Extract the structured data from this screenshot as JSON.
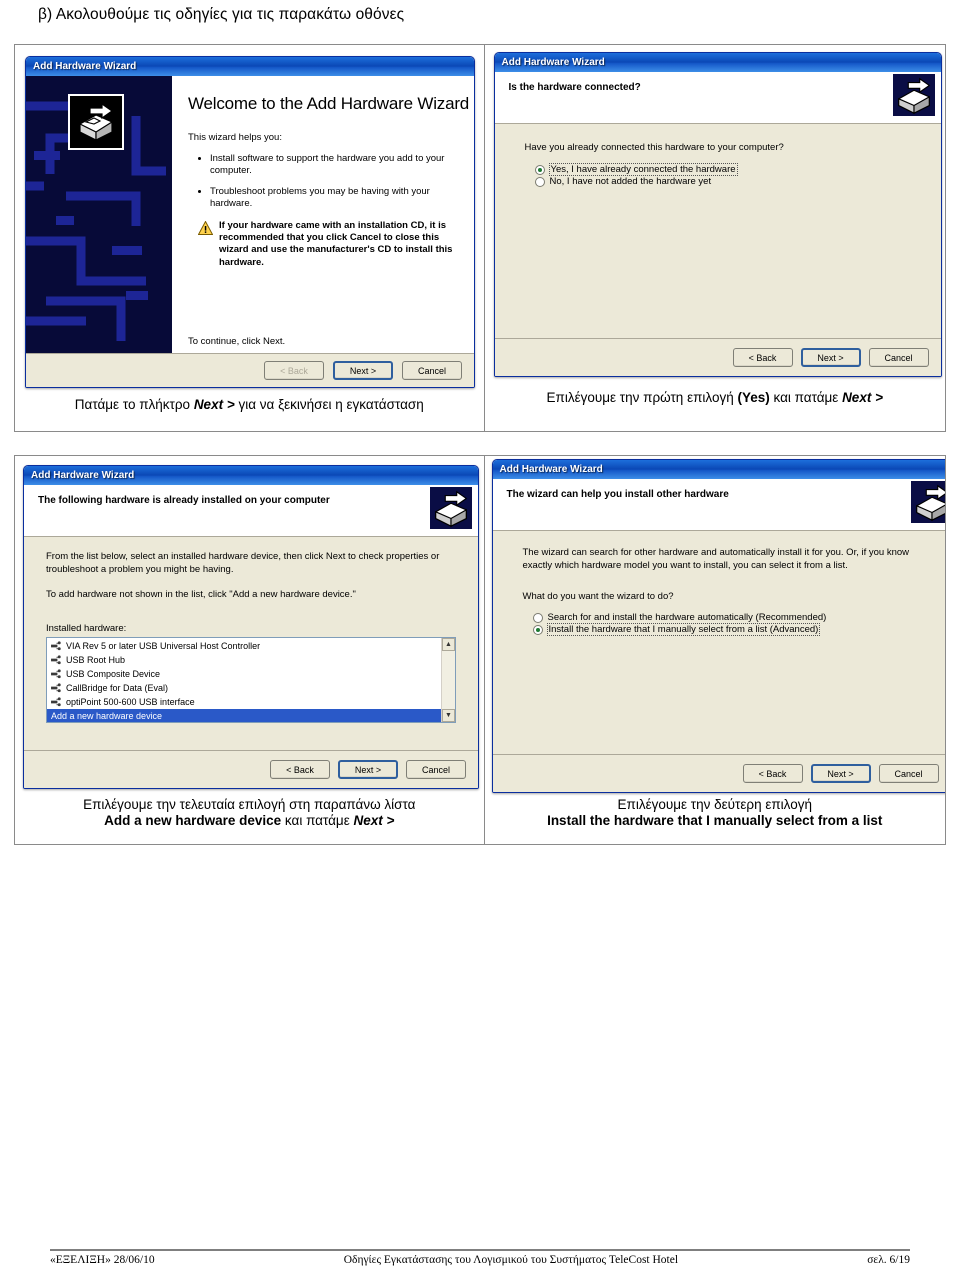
{
  "page": {
    "heading": "β) Ακολουθούμε τις οδηγίες για τις παρακάτω οθόνες"
  },
  "window_title": "Add Hardware Wizard",
  "wizard1": {
    "title": "Add Hardware Wizard",
    "heading": "Welcome to the Add Hardware Wizard",
    "intro": "This wizard helps you:",
    "bullets": [
      "Install software to support the hardware you add to your computer.",
      "Troubleshoot problems you may be having with your hardware."
    ],
    "warning": "If your hardware came with an installation CD, it is recommended that you click Cancel to close this wizard and use the manufacturer's CD to install this hardware.",
    "continue": "To continue, click Next.",
    "buttons": {
      "back": "< Back",
      "next": "Next >",
      "cancel": "Cancel"
    }
  },
  "wizard2": {
    "title": "Add Hardware Wizard",
    "heading": "Is the hardware connected?",
    "question": "Have you already connected this hardware to your computer?",
    "options": [
      {
        "label": "Yes, I have already connected the hardware",
        "selected": true
      },
      {
        "label": "No, I have not added the hardware yet",
        "selected": false
      }
    ],
    "buttons": {
      "back": "< Back",
      "next": "Next >",
      "cancel": "Cancel"
    }
  },
  "wizard3": {
    "title": "Add Hardware Wizard",
    "heading": "The following hardware is already installed on your computer",
    "para1": "From the list below, select an installed hardware device, then click Next to check properties or troubleshoot a problem you might be having.",
    "para2": "To add hardware not shown in the list, click \"Add a new hardware device.\"",
    "list_label": "Installed hardware:",
    "list_items": [
      {
        "label": "VIA Rev 5 or later USB Universal Host Controller",
        "selected": false
      },
      {
        "label": "USB Root Hub",
        "selected": false
      },
      {
        "label": "USB Composite Device",
        "selected": false
      },
      {
        "label": "CallBridge for Data (Eval)",
        "selected": false
      },
      {
        "label": "optiPoint 500-600 USB interface",
        "selected": false
      },
      {
        "label": "Add a new hardware device",
        "selected": true
      }
    ],
    "buttons": {
      "back": "< Back",
      "next": "Next >",
      "cancel": "Cancel"
    }
  },
  "wizard4": {
    "title": "Add Hardware Wizard",
    "heading": "The wizard can help you install other hardware",
    "para1": "The wizard can search for other hardware and automatically install it for you. Or, if you know exactly which hardware model you want to install, you can select it from a list.",
    "question": "What do you want the wizard to do?",
    "options": [
      {
        "label": "Search for and install the hardware automatically (Recommended)",
        "selected": false
      },
      {
        "label": "Install the hardware that I manually select from a list (Advanced)",
        "selected": true
      }
    ],
    "buttons": {
      "back": "< Back",
      "next": "Next >",
      "cancel": "Cancel"
    }
  },
  "captions": {
    "c1": "Πατάμε το πλήκτρο <i>Next &gt;</i> για να ξεκινήσει η εγκατάσταση",
    "c2": "Επιλέγουμε την πρώτη επιλογή <b>(Yes)</b> και πατάμε <i>Next &gt;</i>",
    "c3": "Επιλέγουμε την τελευταία  επιλογή στη παραπάνω λίστα<br><b>Add a new hardware device</b> και πατάμε <i>Next &gt;</i>",
    "c4": "Επιλέγουμε την δεύτερη επιλογή<br><b>Install the hardware that I manually select from a list</b>"
  },
  "footer": {
    "left": "«ΕΞΕΛΙΞΗ» 28/06/10",
    "middle": "Οδηγίες Εγκατάστασης του Λογισμικού του Συστήματος TeleCost Hotel",
    "right": "σελ. 6/19"
  }
}
